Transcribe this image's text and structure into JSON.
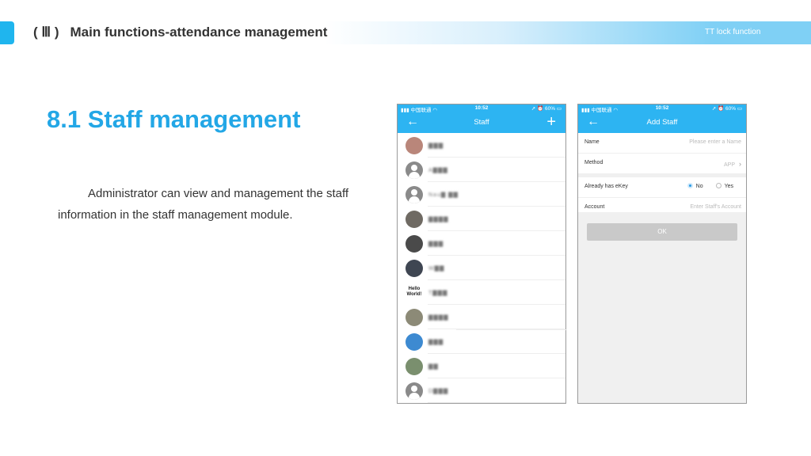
{
  "header": {
    "section_number": "( Ⅲ )",
    "title": "Main functions-attendance management",
    "right_label": "TT lock function"
  },
  "main": {
    "section_title": "8.1 Staff management",
    "description": "Administrator can view and management the staff information in the staff management module."
  },
  "phone_staff": {
    "status": {
      "carrier": "中国联通",
      "time": "10:52",
      "battery": "60%"
    },
    "title": "Staff",
    "items": [
      {
        "name": "▇▇▇",
        "avatar": "photo",
        "color": "#b9867a"
      },
      {
        "name": "A▇▇▇",
        "avatar": "default",
        "color": "#8a8a8a"
      },
      {
        "name": "Nau▇ ▇▇",
        "avatar": "default",
        "color": "#8a8a8a"
      },
      {
        "name": "▇▇▇▇",
        "avatar": "photo",
        "color": "#6f6a63"
      },
      {
        "name": "▇▇▇",
        "avatar": "photo",
        "color": "#4a4a4a"
      },
      {
        "name": "W▇▇",
        "avatar": "photo",
        "color": "#3f4652"
      },
      {
        "name": "T▇▇▇",
        "avatar": "text",
        "avatar_text": "Hello World!",
        "color": "#ffffff"
      },
      {
        "name": "▇▇▇▇",
        "avatar": "photo",
        "color": "#8c8a77"
      },
      {
        "name": "▇▇▇",
        "avatar": "photo",
        "color": "#3d8ad1"
      },
      {
        "name": "▇▇",
        "avatar": "photo",
        "color": "#7a8f6e"
      },
      {
        "name": "D▇▇▇",
        "avatar": "default",
        "color": "#8a8a8a"
      }
    ]
  },
  "phone_add": {
    "status": {
      "carrier": "中国联通",
      "time": "10:52",
      "battery": "60%"
    },
    "title": "Add Staff",
    "name_label": "Name",
    "name_placeholder": "Please enter a Name",
    "method_label": "Method",
    "method_value": "APP",
    "ekey_label": "Already has eKey",
    "ekey_options": [
      "No",
      "Yes"
    ],
    "ekey_selected": "No",
    "account_label": "Account",
    "account_placeholder": "Enter Staff's Account",
    "ok_label": "OK"
  },
  "colors": {
    "accent": "#23a7e6",
    "navbar": "#2db4f2",
    "header_tab": "#1fb5ee"
  }
}
